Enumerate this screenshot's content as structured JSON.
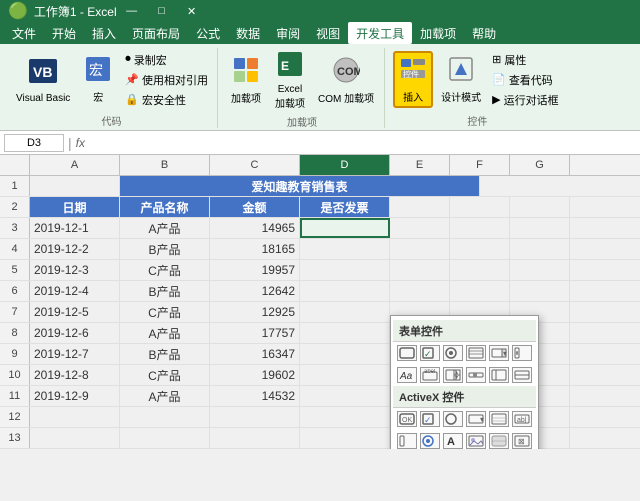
{
  "title": "工作簿1 - Excel",
  "titleControls": [
    "—",
    "□",
    "✕"
  ],
  "menuItems": [
    "文件",
    "开始",
    "插入",
    "页面布局",
    "公式",
    "数据",
    "审阅",
    "视图",
    "开发工具",
    "加载项",
    "帮助"
  ],
  "activeMenu": "开发工具",
  "ribbonGroups": {
    "code": {
      "label": "代码",
      "items": [
        "Visual Basic",
        "宏",
        "录制宏",
        "使用相对引用",
        "宏安全性"
      ]
    },
    "addins": {
      "label": "加载项",
      "items": [
        "加载项",
        "Excel加载项",
        "COM加载项"
      ]
    },
    "controls": {
      "label": "控件",
      "items": [
        "插入",
        "设计模式",
        "属性",
        "查看代码",
        "运行对话框"
      ]
    }
  },
  "cellRef": "D3",
  "formulaContent": "",
  "columns": [
    "A",
    "B",
    "C",
    "D",
    "E",
    "F",
    "G"
  ],
  "sheetTitle": "爱知趣教育销售表",
  "headers": [
    "日期",
    "产品名称",
    "金额",
    "是否发票"
  ],
  "rows": [
    {
      "num": 3,
      "date": "2019-12-1",
      "product": "A产品",
      "amount": "14965",
      "invoice": ""
    },
    {
      "num": 4,
      "date": "2019-12-2",
      "product": "B产品",
      "amount": "18165",
      "invoice": ""
    },
    {
      "num": 5,
      "date": "2019-12-3",
      "product": "C产品",
      "amount": "19957",
      "invoice": ""
    },
    {
      "num": 6,
      "date": "2019-12-4",
      "product": "B产品",
      "amount": "12642",
      "invoice": ""
    },
    {
      "num": 7,
      "date": "2019-12-5",
      "product": "C产品",
      "amount": "12925",
      "invoice": ""
    },
    {
      "num": 8,
      "date": "2019-12-6",
      "product": "A产品",
      "amount": "17757",
      "invoice": ""
    },
    {
      "num": 9,
      "date": "2019-12-7",
      "product": "B产品",
      "amount": "16347",
      "invoice": ""
    },
    {
      "num": 10,
      "date": "2019-12-8",
      "product": "C产品",
      "amount": "19602",
      "invoice": ""
    },
    {
      "num": 11,
      "date": "2019-12-9",
      "product": "A产品",
      "amount": "14532",
      "invoice": ""
    }
  ],
  "emptyRows": [
    12,
    13
  ],
  "popup": {
    "sections": [
      {
        "label": "表单控件",
        "icons": [
          [
            "□",
            "✓",
            "⊙",
            "⊞",
            "◎",
            "⟨ ⟩"
          ],
          [
            "Aa",
            "abel",
            "⊟",
            "⊡",
            "⊟",
            "⊡"
          ]
        ]
      },
      {
        "label": "ActiveX 控件",
        "icons": [
          [
            "□",
            "✓",
            "⊙",
            "⊞",
            "◎",
            "⟨ ⟩"
          ],
          [
            "☰",
            "◎",
            "A",
            "⊡",
            "⊡",
            "⊠"
          ]
        ]
      }
    ]
  },
  "colors": {
    "excel_green": "#217346",
    "header_blue": "#4472c4",
    "ribbon_bg": "#e8f4ec",
    "cell_border": "#c0c0c0",
    "selected_highlight": "#ffd700"
  }
}
